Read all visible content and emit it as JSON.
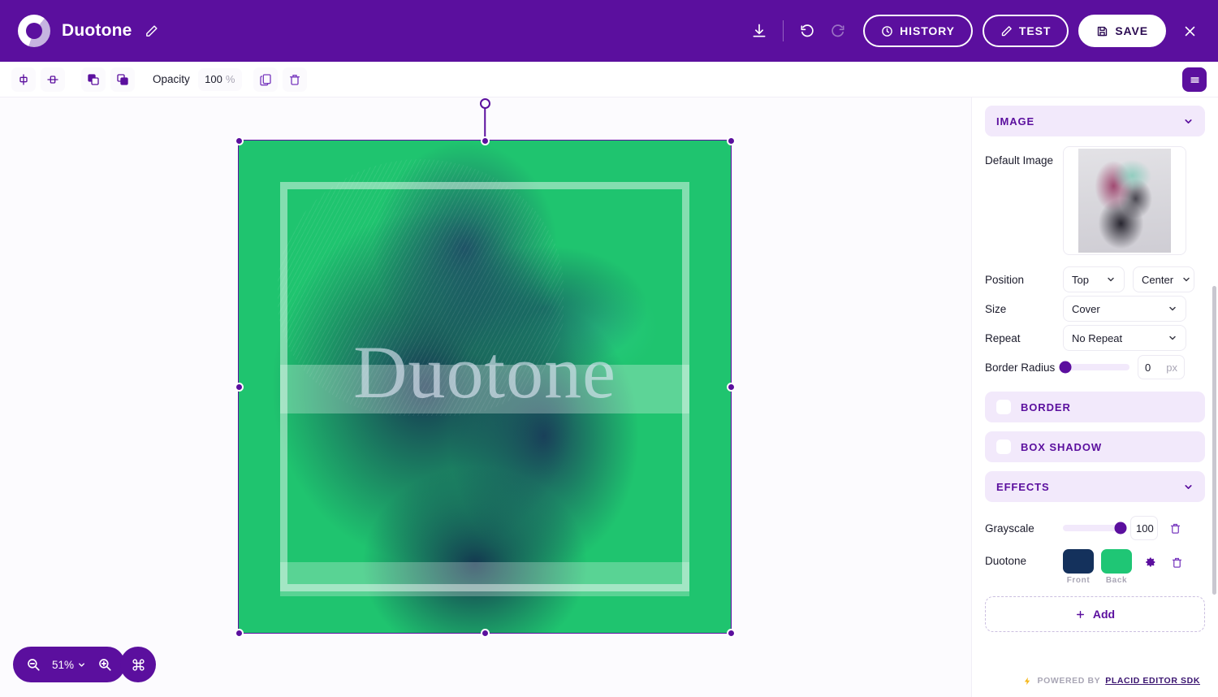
{
  "header": {
    "project_title": "Duotone",
    "edit_icon": "pencil-icon",
    "download_icon": "download-icon",
    "undo_icon": "undo-icon",
    "redo_icon": "redo-icon",
    "history_label": "HISTORY",
    "test_label": "TEST",
    "save_label": "SAVE",
    "close_icon": "close-icon",
    "bg_color": "#5b0f9e"
  },
  "toolbar": {
    "align_horizontal_icon": "align-horizontal-center-icon",
    "align_vertical_icon": "align-vertical-center-icon",
    "bring_front_icon": "bring-to-front-icon",
    "send_back_icon": "send-to-back-icon",
    "opacity_label": "Opacity",
    "opacity_value": "100",
    "opacity_unit": "%",
    "duplicate_icon": "duplicate-icon",
    "delete_icon": "trash-icon",
    "menu_icon": "hamburger-menu-icon"
  },
  "left_rail": {
    "items": [
      {
        "name": "text-tool",
        "icon": "text-icon"
      },
      {
        "name": "rectangle-tool",
        "icon": "square-icon"
      },
      {
        "name": "image-tool",
        "icon": "image-icon"
      },
      {
        "name": "browser-tool",
        "icon": "rounded-rect-icon"
      }
    ]
  },
  "canvas": {
    "watermark_text": "Duotone",
    "artboard_bg": "#1fc46f",
    "selection_color": "#5b0f9e"
  },
  "zoom": {
    "zoom_out_icon": "zoom-out-icon",
    "zoom_in_icon": "zoom-in-icon",
    "level": "51%",
    "chevron": "chevron-down-icon",
    "shortcut_icon": "command-key-icon"
  },
  "panel": {
    "image_section": {
      "title": "IMAGE",
      "chevron": "chevron-down-icon",
      "default_image_label": "Default Image",
      "position_label": "Position",
      "position_vertical": "Top",
      "position_horizontal": "Center",
      "size_label": "Size",
      "size_value": "Cover",
      "repeat_label": "Repeat",
      "repeat_value": "No Repeat",
      "border_radius_label": "Border Radius",
      "border_radius_value": "0",
      "border_radius_unit": "px"
    },
    "border_section": {
      "title": "BORDER",
      "enabled": false
    },
    "box_shadow_section": {
      "title": "BOX SHADOW",
      "enabled": false
    },
    "effects_section": {
      "title": "EFFECTS",
      "chevron": "chevron-down-icon",
      "grayscale_label": "Grayscale",
      "grayscale_value": "100",
      "duotone_label": "Duotone",
      "duotone_front_caption": "Front",
      "duotone_back_caption": "Back",
      "duotone_front_color": "#14315c",
      "duotone_back_color": "#1fc675",
      "settings_icon": "gear-icon",
      "delete_icon": "trash-icon",
      "add_label": "Add",
      "add_icon": "plus-icon"
    },
    "footer": {
      "bolt_icon": "lightning-bolt-icon",
      "powered_by": "POWERED BY",
      "sdk_name": "PLACID EDITOR SDK"
    }
  }
}
